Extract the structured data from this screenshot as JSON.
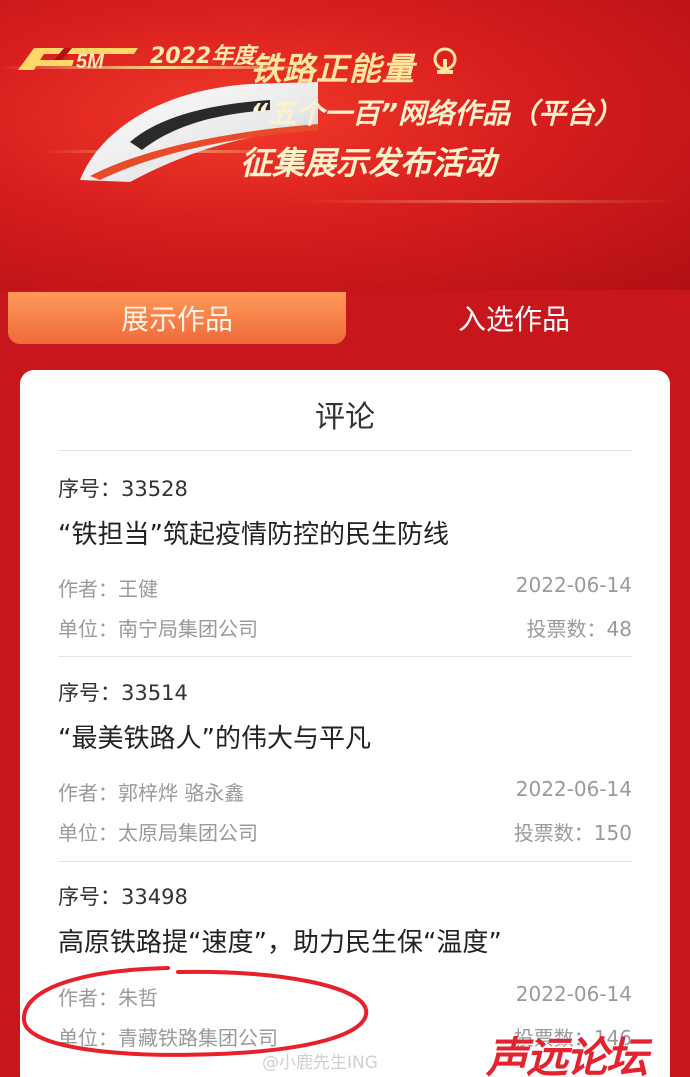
{
  "banner": {
    "logo_text": "5M",
    "year": "2022年度",
    "title_line1": "铁路正能量",
    "title_line2": "“五个一百”网络作品（平台）",
    "title_line3": "征集展示发布活动"
  },
  "tabs": [
    {
      "label": "展示作品",
      "active": true
    },
    {
      "label": "入选作品",
      "active": false
    }
  ],
  "card": {
    "title": "评论",
    "items": [
      {
        "serial": "序号：33528",
        "title": "“铁担当”筑起疫情防控的民生防线",
        "author": "作者：王健",
        "date": "2022-06-14",
        "unit": "单位：南宁局集团公司",
        "votes": "投票数：48"
      },
      {
        "serial": "序号：33514",
        "title": "“最美铁路人”的伟大与平凡",
        "author": "作者：郭梓烨 骆永鑫",
        "date": "2022-06-14",
        "unit": "单位：太原局集团公司",
        "votes": "投票数：150"
      },
      {
        "serial": "序号：33498",
        "title": "高原铁路提“速度”，助力民生保“温度”",
        "author": "作者：朱哲",
        "date": "2022-06-14",
        "unit": "单位：青藏铁路集团公司",
        "votes": "投票数：146"
      }
    ]
  },
  "overlays": {
    "watermark": "@小鹿先生ING",
    "site_logo": "声远论坛",
    "circle_color": "#e8202a"
  },
  "colors": {
    "brand_red": "#c8161d",
    "tab_active": "#f06a3a",
    "meta_gray": "#9a9a9a"
  }
}
